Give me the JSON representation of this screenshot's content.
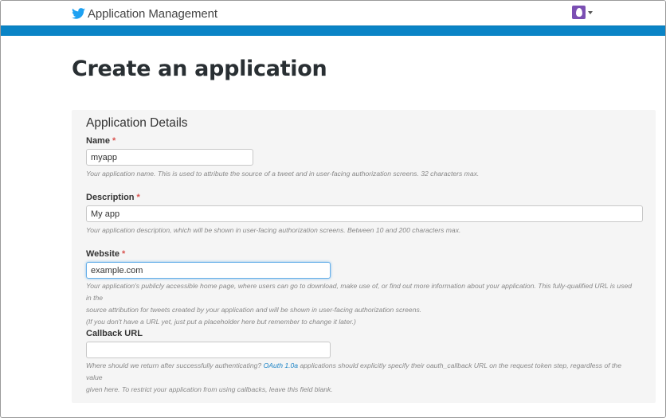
{
  "header": {
    "brand_title": "Application Management",
    "logo_icon": "twitter-bird-icon",
    "avatar_icon": "egg-avatar-icon",
    "accent_color": "#0a84c6"
  },
  "page": {
    "title": "Create an application"
  },
  "form": {
    "section_title": "Application Details",
    "required_marker": "*",
    "name": {
      "label": "Name",
      "value": "myapp",
      "help": "Your application name. This is used to attribute the source of a tweet and in user-facing authorization screens. 32 characters max."
    },
    "description": {
      "label": "Description",
      "value": "My app",
      "help": "Your application description, which will be shown in user-facing authorization screens. Between 10 and 200 characters max."
    },
    "website": {
      "label": "Website",
      "value": "example.com",
      "help_line1": "Your application's publicly accessible home page, where users can go to download, make use of, or find out more information about your application. This fully-qualified URL is used in the",
      "help_line2": "source attribution for tweets created by your application and will be shown in user-facing authorization screens.",
      "help_line3": "(If you don't have a URL yet, just put a placeholder here but remember to change it later.)"
    },
    "callback": {
      "label": "Callback URL",
      "value": "",
      "help_pre": "Where should we return after successfully authenticating?",
      "help_link": "OAuth 1.0a",
      "help_post": "applications should explicitly specify their oauth_callback URL on the request token step, regardless of the value",
      "help_line2": "given here. To restrict your application from using callbacks, leave this field blank."
    }
  }
}
